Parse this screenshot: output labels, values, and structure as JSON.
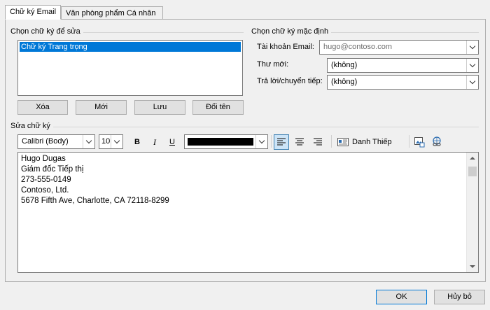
{
  "tabs": [
    {
      "label": "Chữ ký Email"
    },
    {
      "label": "Văn phòng phẩm Cá nhân"
    }
  ],
  "select_section": {
    "label": "Chọn chữ ký để sửa",
    "items": [
      "Chữ ký Trang trọng"
    ],
    "buttons": {
      "delete": "Xóa",
      "new": "Mới",
      "save": "Lưu",
      "rename": "Đổi tên"
    }
  },
  "default_section": {
    "label": "Chọn chữ ký mặc định",
    "account_label": "Tài khoản Email:",
    "account_value": "hugo@contoso.com",
    "new_messages_label": "Thư mới:",
    "new_messages_value": "(không)",
    "replies_label": "Trả lời/chuyển tiếp:",
    "replies_value": "(không)"
  },
  "edit_section": {
    "label": "Sửa chữ ký",
    "font": "Calibri (Body)",
    "size": "10",
    "bold": "B",
    "italic": "I",
    "underline": "U",
    "color": "#000000",
    "business_card": "Danh Thiếp",
    "alignment": "left"
  },
  "signature_lines": [
    "Hugo Dugas",
    "Giám đốc Tiếp thị",
    "273-555-0149",
    "Contoso, Ltd.",
    "5678 Fifth Ave, Charlotte, CA 72118-8299"
  ],
  "footer": {
    "ok": "OK",
    "cancel": "Hủy bỏ"
  },
  "icons": [
    "align-left-icon",
    "align-center-icon",
    "align-right-icon",
    "business-card-icon",
    "insert-picture-icon",
    "insert-hyperlink-icon"
  ]
}
